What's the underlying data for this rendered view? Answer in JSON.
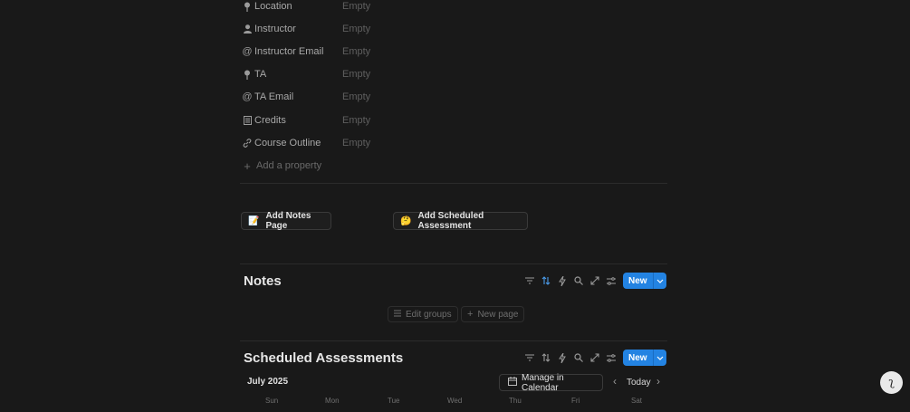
{
  "properties": [
    {
      "name": "Location",
      "value": "Empty",
      "icon": "pin-icon"
    },
    {
      "name": "Instructor",
      "value": "Empty",
      "icon": "person-icon"
    },
    {
      "name": "Instructor Email",
      "value": "Empty",
      "icon": "at-icon"
    },
    {
      "name": "TA",
      "value": "Empty",
      "icon": "pin-icon"
    },
    {
      "name": "TA Email",
      "value": "Empty",
      "icon": "at-icon"
    },
    {
      "name": "Credits",
      "value": "Empty",
      "icon": "book-icon"
    },
    {
      "name": "Course Outline",
      "value": "Empty",
      "icon": "link-icon"
    }
  ],
  "add_property": "Add a property",
  "actions": {
    "notes": "Add Notes Page",
    "assessment": "Add Scheduled Assessment"
  },
  "notes_db": {
    "title": "Notes",
    "new_label": "New",
    "edit_groups": "Edit groups",
    "new_page": "New page"
  },
  "assessments_db": {
    "title": "Scheduled Assessments",
    "new_label": "New"
  },
  "calendar": {
    "month": "July 2025",
    "manage": "Manage in Calendar",
    "today": "Today",
    "days": [
      "Sun",
      "Mon",
      "Tue",
      "Wed",
      "Thu",
      "Fri",
      "Sat"
    ]
  },
  "colors": {
    "background": "#191919",
    "accent": "#2383e2"
  }
}
